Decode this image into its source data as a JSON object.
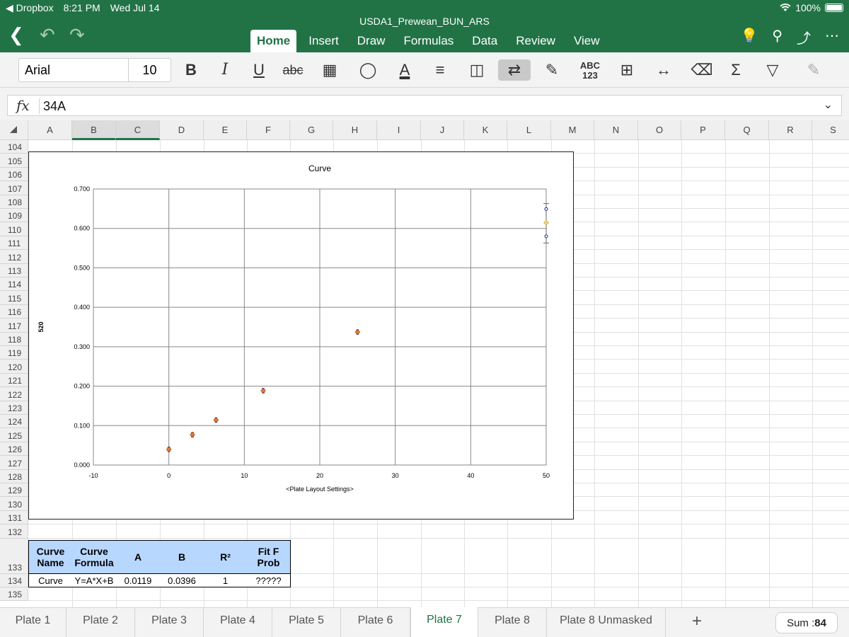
{
  "status_bar": {
    "back_app": "◀ Dropbox",
    "time": "8:21 PM",
    "date": "Wed Jul 14",
    "wifi": "wifi",
    "battery_pct": "100%"
  },
  "document": {
    "title": "USDA1_Prewean_BUN_ARS"
  },
  "menu_tabs": [
    "Home",
    "Insert",
    "Draw",
    "Formulas",
    "Data",
    "Review",
    "View"
  ],
  "active_menu_tab": "Home",
  "ribbon": {
    "font_name": "Arial",
    "font_size": "10",
    "bold": "B",
    "italic": "I",
    "underline": "U",
    "strike": "abc",
    "number_format": "ABC 123",
    "sum": "Σ"
  },
  "formula_bar": {
    "fx": "fx",
    "value": "34A"
  },
  "columns": [
    "A",
    "B",
    "C",
    "D",
    "E",
    "F",
    "G",
    "H",
    "I",
    "J",
    "K",
    "L",
    "M",
    "N",
    "O",
    "P",
    "Q",
    "R",
    "S"
  ],
  "selected_columns": [
    "B",
    "C"
  ],
  "rows": [
    "104",
    "105",
    "106",
    "107",
    "108",
    "109",
    "110",
    "111",
    "112",
    "113",
    "114",
    "115",
    "116",
    "117",
    "118",
    "119",
    "120",
    "121",
    "122",
    "123",
    "124",
    "125",
    "126",
    "127",
    "128",
    "129",
    "130",
    "131",
    "132",
    "133",
    "134",
    "135"
  ],
  "chart_data": {
    "type": "scatter",
    "title": "Curve",
    "xlabel": "<Plate Layout Settings>",
    "ylabel": "520",
    "xlim": [
      -10,
      50
    ],
    "ylim": [
      0,
      0.7
    ],
    "x_ticks": [
      "-10",
      "0",
      "10",
      "20",
      "30",
      "40",
      "50"
    ],
    "y_ticks": [
      "0.000",
      "0.100",
      "0.200",
      "0.300",
      "0.400",
      "0.500",
      "0.600",
      "0.700"
    ],
    "grid": true,
    "series": [
      {
        "x": [
          0,
          3.125,
          6.25,
          12.5,
          25,
          50
        ],
        "y": [
          0.0396,
          0.0768,
          0.1139,
          0.1884,
          0.3371,
          0.6146
        ],
        "color": "#e07a2e"
      }
    ],
    "error_bar": {
      "x": 50,
      "low": 0.563,
      "high": 0.663,
      "replicates": [
        0.649,
        0.58
      ]
    }
  },
  "table": {
    "headers": [
      "Curve Name",
      "Curve Formula",
      "A",
      "B",
      "R²",
      "Fit F Prob"
    ],
    "rows": [
      [
        "Curve",
        "Y=A*X+B",
        "0.0119",
        "0.0396",
        "1",
        "?????"
      ]
    ]
  },
  "sheet_tabs": [
    "Plate 1",
    "Plate 2",
    "Plate 3",
    "Plate 4",
    "Plate 5",
    "Plate 6",
    "Plate 7",
    "Plate 8",
    "Plate 8 Unmasked"
  ],
  "active_sheet": "Plate 7",
  "add_sheet": "+",
  "sum": {
    "label": "Sum :",
    "value": "84"
  },
  "colors": {
    "accent": "#217346",
    "header_fill": "#b8d7ff",
    "marker": "#e07a2e"
  }
}
